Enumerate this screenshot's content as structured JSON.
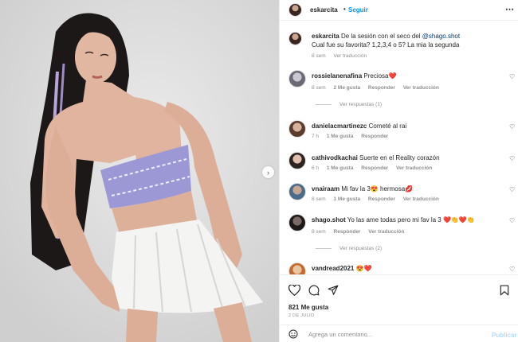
{
  "post": {
    "username": "eskarcita",
    "follow_label": "Seguir",
    "more_icon": "⋯"
  },
  "caption": {
    "username": "eskarcita",
    "text_before_tag": "De la sesión con el seco del",
    "tag": "@shago.shot",
    "text_after_tag": "Cual fue su favorita? 1,2,3,4 o 5? La mia la segunda",
    "time": "8 sem",
    "translate": "Ver traducción"
  },
  "comments": [
    {
      "username": "rossielanenafina",
      "text": "Preciosa❤️",
      "time": "8 sem",
      "likes": "2 Me gusta",
      "reply": "Responder",
      "translate": "Ver traducción",
      "replies_label": "Ver respuestas (1)"
    },
    {
      "username": "danielacmartinezc",
      "text": "Cometé al rai",
      "time": "7 h",
      "likes": "1 Me gusta",
      "reply": "Responder"
    },
    {
      "username": "cathivodkachai",
      "text": "Suerte en el Reality corazón",
      "time": "6 h",
      "likes": "1 Me gusta",
      "reply": "Responder",
      "translate": "Ver traducción"
    },
    {
      "username": "vnairaam",
      "text": "Mi fav la 3😍 hermosa💋",
      "time": "8 sem",
      "likes": "1 Me gusta",
      "reply": "Responder",
      "translate": "Ver traducción"
    },
    {
      "username": "shago.shot",
      "text": "Yo las ame todas pero mi fav la 3 ❤️👏❤️👏",
      "time": "8 sem",
      "reply": "Responder",
      "translate": "Ver traducción",
      "replies_label": "Ver respuestas (2)"
    },
    {
      "username": "vandread2021",
      "text": "😍❤️"
    }
  ],
  "likes_count": "821 Me gusta",
  "date": "2 DE JULIO",
  "comment_input": {
    "placeholder": "Agrega un comentario...",
    "publish_label": "Publicar"
  },
  "icons": [
    "more-icon",
    "heart-icon",
    "comment-icon",
    "share-icon",
    "bookmark-icon",
    "emoji-icon",
    "chevron-right-icon"
  ],
  "colors": {
    "link": "#0095f6",
    "publish_disabled": "#b3dbff",
    "muted": "#8e8e8e",
    "heart_red": "#ed4956"
  }
}
